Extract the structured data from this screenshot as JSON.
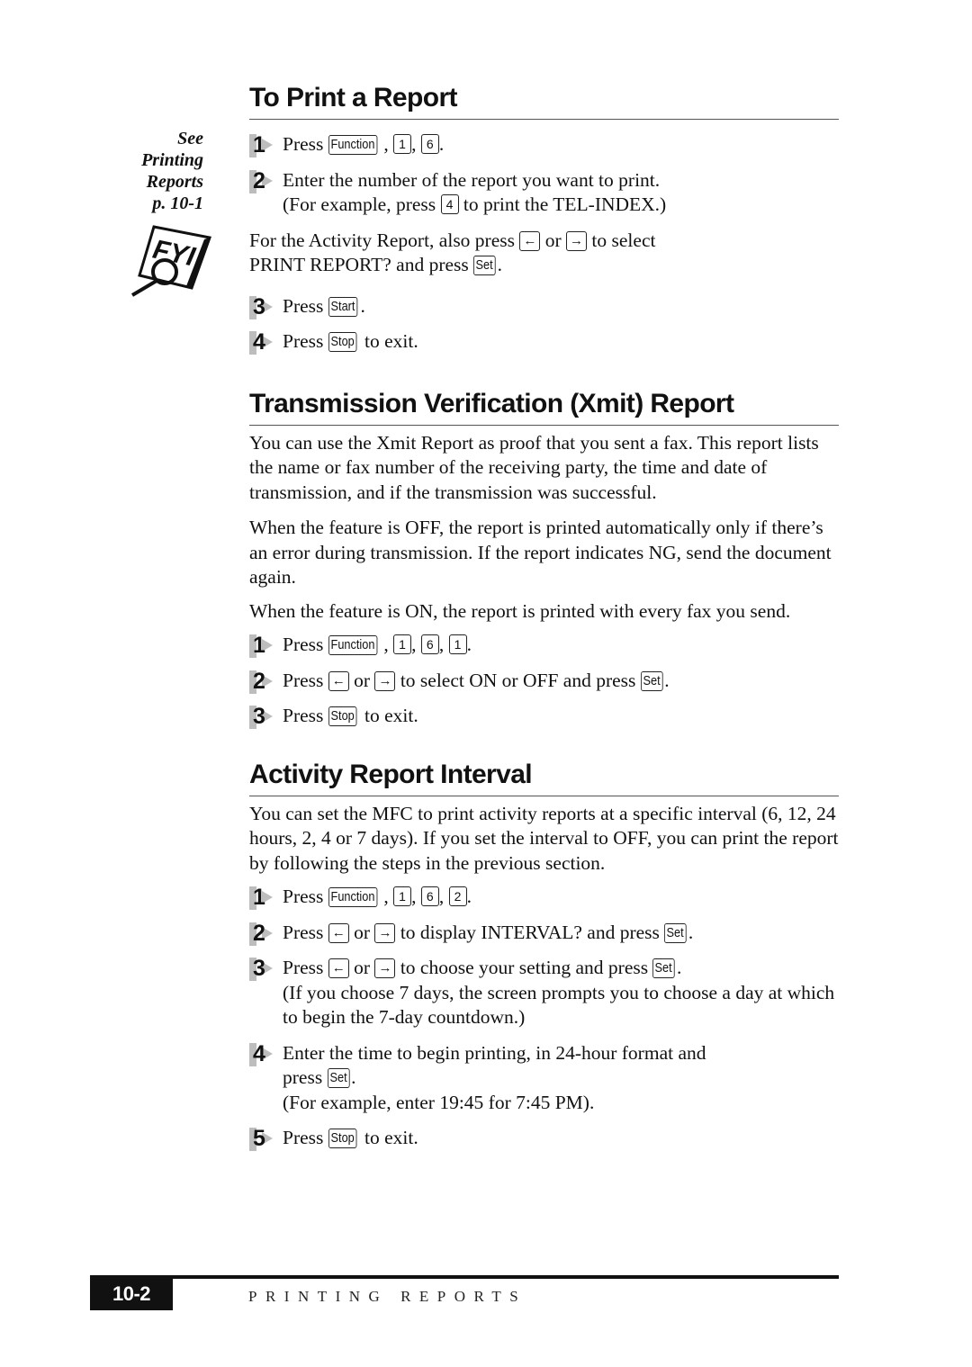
{
  "sidebar": {
    "note_lines": [
      "See",
      "Printing",
      "Reports",
      "p. 10-1"
    ],
    "fyi_icon": "fyi-magnifier-icon",
    "fyi_label": "FYI"
  },
  "sections": [
    {
      "title": "To Print a Report",
      "steps_a": [
        {
          "num": "1",
          "parts": [
            "Press ",
            {
              "key": "Function"
            },
            ", ",
            {
              "key": "1"
            },
            ", ",
            {
              "key": "6"
            },
            "."
          ]
        },
        {
          "num": "2",
          "parts": [
            "Enter the number of the report you want to print.",
            {
              "br": true
            },
            "(For example, press ",
            {
              "key": "4"
            },
            " to print the TEL-INDEX.)"
          ]
        }
      ],
      "note": [
        "For the Activity Report, also press ",
        {
          "key": "←"
        },
        " or ",
        {
          "key": "→"
        },
        " to select",
        {
          "br": true
        },
        "PRINT REPORT? and press ",
        {
          "key": "Set"
        },
        "."
      ],
      "steps_b": [
        {
          "num": "3",
          "parts": [
            "Press ",
            {
              "key": "Start"
            },
            "."
          ]
        },
        {
          "num": "4",
          "parts": [
            "Press ",
            {
              "key": "Stop"
            },
            " to exit."
          ]
        }
      ]
    },
    {
      "title": "Transmission Verification (Xmit) Report",
      "paragraphs": [
        "You can use the Xmit Report as proof that you sent a fax.  This report lists the name or fax number of the receiving party, the time and date of transmission, and if the transmission was successful.",
        "When the feature is OFF, the report is printed automatically only if there’s an error during transmission.  If the report indicates NG, send the document again.",
        "When the feature is ON, the report is printed with every fax you send."
      ],
      "steps": [
        {
          "num": "1",
          "parts": [
            "Press ",
            {
              "key": "Function"
            },
            ", ",
            {
              "key": "1"
            },
            ", ",
            {
              "key": "6"
            },
            ", ",
            {
              "key": "1"
            },
            "."
          ]
        },
        {
          "num": "2",
          "parts": [
            "Press ",
            {
              "key": "←"
            },
            " or ",
            {
              "key": "→"
            },
            " to select ON or OFF and press ",
            {
              "key": "Set"
            },
            "."
          ]
        },
        {
          "num": "3",
          "parts": [
            "Press ",
            {
              "key": "Stop"
            },
            " to exit."
          ]
        }
      ]
    },
    {
      "title": "Activity Report Interval",
      "paragraphs": [
        "You can set the MFC to print activity reports at a specific interval (6, 12, 24 hours, 2, 4 or 7 days).  If you set the interval to OFF, you can print the report by following the steps in the previous section."
      ],
      "steps": [
        {
          "num": "1",
          "parts": [
            "Press ",
            {
              "key": "Function"
            },
            ", ",
            {
              "key": "1"
            },
            ", ",
            {
              "key": "6"
            },
            ", ",
            {
              "key": "2"
            },
            "."
          ]
        },
        {
          "num": "2",
          "parts": [
            "Press ",
            {
              "key": "←"
            },
            " or ",
            {
              "key": "→"
            },
            " to display INTERVAL? and press ",
            {
              "key": "Set"
            },
            "."
          ]
        },
        {
          "num": "3",
          "parts": [
            "Press ",
            {
              "key": "←"
            },
            " or ",
            {
              "key": "→"
            },
            " to choose your setting and press ",
            {
              "key": "Set"
            },
            ".",
            {
              "br": true
            },
            "(If you choose 7 days, the screen prompts you to choose a day at which to begin the 7-day countdown.)"
          ]
        },
        {
          "num": "4",
          "parts": [
            "Enter the time to begin printing, in 24-hour format and",
            {
              "br": true
            },
            "press ",
            {
              "key": "Set"
            },
            ".",
            {
              "br": true
            },
            "(For example, enter 19:45 for 7:45 PM)."
          ]
        },
        {
          "num": "5",
          "parts": [
            "Press ",
            {
              "key": "Stop"
            },
            " to exit."
          ]
        }
      ]
    }
  ],
  "footer": {
    "page_number": "10-2",
    "running_head": "PRINTING REPORTS"
  }
}
